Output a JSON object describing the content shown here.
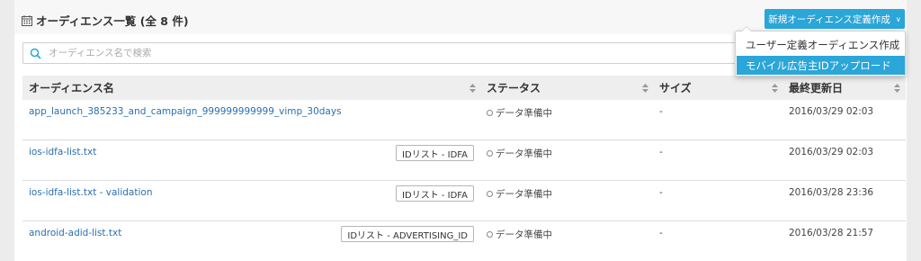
{
  "header": {
    "title": "オーディエンス一覧 (全 8 件)",
    "new_button_label": "新規オーディエンス定義作成",
    "new_button_chevron": "∨"
  },
  "search": {
    "placeholder": "オーディエンス名で検索",
    "value": ""
  },
  "table": {
    "columns": [
      "オーディエンス名",
      "ステータス",
      "サイズ",
      "最終更新日"
    ],
    "rows": [
      {
        "name": "app_launch_385233_and_campaign_999999999999_vimp_30days",
        "badge": "",
        "status": "データ準備中",
        "size": "-",
        "updated": "2016/03/29 02:03"
      },
      {
        "name": "ios-idfa-list.txt",
        "badge": "IDリスト - IDFA",
        "status": "データ準備中",
        "size": "-",
        "updated": "2016/03/29 02:03"
      },
      {
        "name": "ios-idfa-list.txt - validation",
        "badge": "IDリスト - IDFA",
        "status": "データ準備中",
        "size": "-",
        "updated": "2016/03/28 23:36"
      },
      {
        "name": "android-adid-list.txt",
        "badge": "IDリスト - ADVERTISING_ID",
        "status": "データ準備中",
        "size": "-",
        "updated": "2016/03/28 21:57"
      }
    ]
  },
  "dropdown": {
    "items": [
      {
        "label": "ユーザー定義オーディエンス作成",
        "active": false
      },
      {
        "label": "モバイル広告主IDアップロード",
        "active": true
      }
    ]
  },
  "colors": {
    "accent": "#2aa6d8",
    "link": "#2a6fb0",
    "header_bg": "#eeeeee"
  },
  "icons": [
    "calendar-icon",
    "search-icon",
    "sort-icon",
    "chevron-down-icon",
    "status-circle-icon"
  ]
}
